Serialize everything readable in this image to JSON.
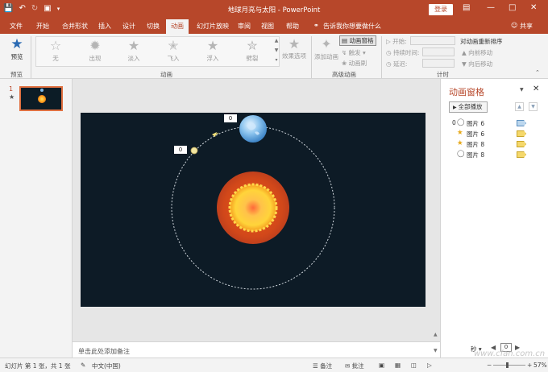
{
  "title_bar": {
    "document_title": "地球月亮与太阳 - PowerPoint",
    "login_label": "登录",
    "share_label": "共享"
  },
  "tabs": [
    "文件",
    "开始",
    "合并形状",
    "插入",
    "设计",
    "切换",
    "动画",
    "幻灯片放映",
    "审阅",
    "视图",
    "帮助"
  ],
  "active_tab": "动画",
  "tell_me": "告诉我你想要做什么",
  "ribbon": {
    "preview": {
      "label": "预览",
      "group_label": "预览"
    },
    "effects": [
      {
        "label": "无",
        "icon": "star-outline-icon"
      },
      {
        "label": "出现",
        "icon": "star-burst-icon"
      },
      {
        "label": "淡入",
        "icon": "star-fade-icon"
      },
      {
        "label": "飞入",
        "icon": "star-fly-icon"
      },
      {
        "label": "浮入",
        "icon": "star-float-icon"
      },
      {
        "label": "劈裂",
        "icon": "star-split-icon"
      }
    ],
    "effect_options_label": "效果选项",
    "animation_group_label": "动画",
    "add_animation_label": "添加动画",
    "animation_pane_label": "动画窗格",
    "trigger_label": "触发",
    "animation_painter_label": "动画刷",
    "advanced_group_label": "高级动画",
    "start_label": "开始:",
    "duration_label": "持续时间:",
    "delay_label": "延迟:",
    "reorder_label": "对动画重新排序",
    "move_earlier_label": "向前移动",
    "move_later_label": "向后移动",
    "timing_group_label": "计时"
  },
  "slides_panel": {
    "slide_number": "1",
    "animation_marker": "★"
  },
  "slide": {
    "label_earth": "0",
    "label_moon": "0"
  },
  "notes_placeholder": "单击此处添加备注",
  "animation_pane": {
    "title": "动画窗格",
    "play_all_label": "全部播放",
    "items": [
      {
        "order": "0",
        "icon": "circle-path-icon",
        "name": "图片 6",
        "bar_color": "#bcd7ee"
      },
      {
        "order": "",
        "icon": "star-icon",
        "name": "图片 6",
        "bar_color": "#f5d86b"
      },
      {
        "order": "",
        "icon": "star-icon",
        "name": "图片 8",
        "bar_color": "#f5d86b"
      },
      {
        "order": "",
        "icon": "circle-path-icon",
        "name": "图片 8",
        "bar_color": "#f5d86b"
      }
    ],
    "seconds_label": "秒",
    "timeline_value": "0"
  },
  "status_bar": {
    "slide_info": "幻灯片 第 1 张，共 1 张",
    "language": "中文(中国)",
    "notes_label": "备注",
    "comments_label": "批注",
    "zoom": "57%"
  },
  "watermark": "www.cfan.com.cn",
  "colors": {
    "accent": "#b7472a",
    "slide_background": "#0d1b26"
  }
}
